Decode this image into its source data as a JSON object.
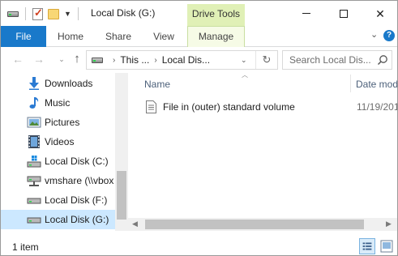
{
  "window": {
    "title": "Local Disk (G:)",
    "context_tab_group": "Drive Tools"
  },
  "ribbon": {
    "tabs": [
      {
        "label": "File"
      },
      {
        "label": "Home"
      },
      {
        "label": "Share"
      },
      {
        "label": "View"
      },
      {
        "label": "Manage"
      }
    ],
    "help": "?"
  },
  "address": {
    "crumbs": [
      "This ...",
      "Local Dis..."
    ],
    "search_placeholder": "Search Local Dis..."
  },
  "nav_pane": {
    "items": [
      {
        "label": "Downloads",
        "icon": "download-arrow-icon"
      },
      {
        "label": "Music",
        "icon": "music-note-icon"
      },
      {
        "label": "Pictures",
        "icon": "pictures-icon"
      },
      {
        "label": "Videos",
        "icon": "videos-icon"
      },
      {
        "label": "Local Disk (C:)",
        "icon": "windows-drive-icon"
      },
      {
        "label": "vmshare (\\\\vbox",
        "icon": "network-drive-icon"
      },
      {
        "label": "Local Disk (F:)",
        "icon": "drive-icon"
      },
      {
        "label": "Local Disk (G:)",
        "icon": "drive-icon",
        "selected": true
      }
    ]
  },
  "content": {
    "columns": {
      "name": "Name",
      "date": "Date mod"
    },
    "files": [
      {
        "name": "File in (outer) standard volume",
        "date": "11/19/201"
      }
    ]
  },
  "status": {
    "item_count": "1 item"
  },
  "colors": {
    "file_tab": "#1979ca",
    "drive_tools": "#e0f0b6",
    "selection": "#cce8ff",
    "column_header_text": "#4c607a"
  }
}
